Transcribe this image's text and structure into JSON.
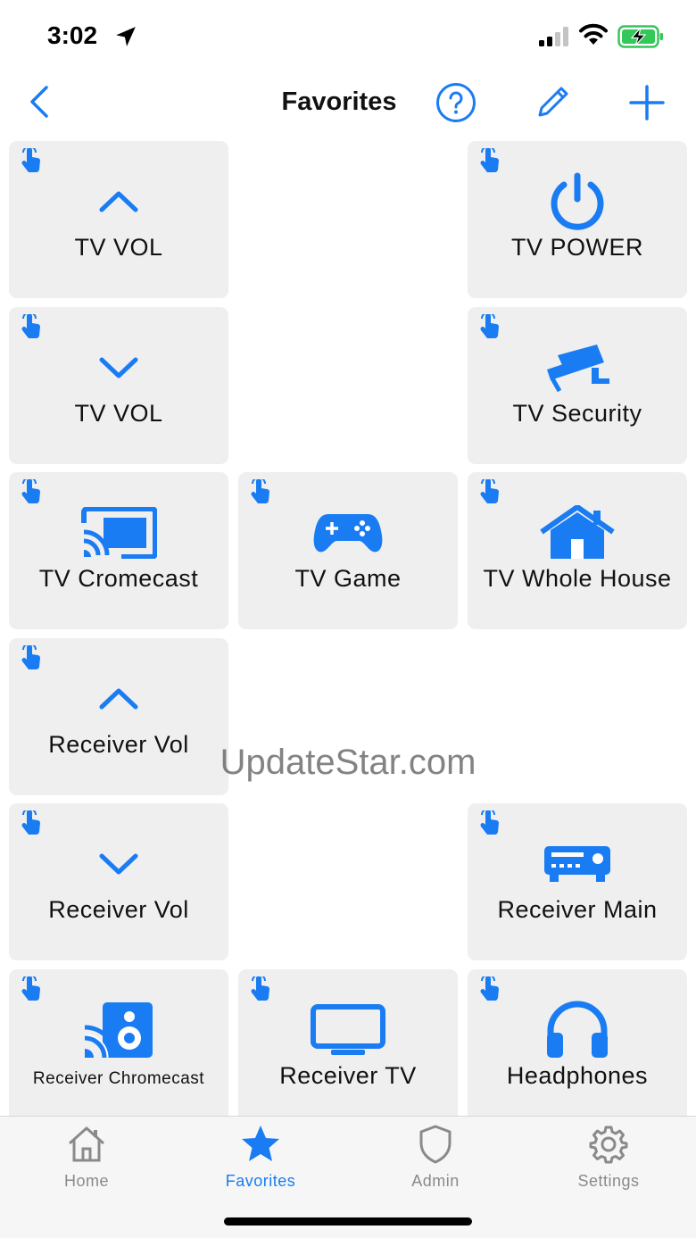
{
  "status_bar": {
    "time": "3:02"
  },
  "nav": {
    "title": "Favorites"
  },
  "colors": {
    "accent": "#1a7cf2",
    "tile_bg": "#efefef",
    "tab_inactive": "#8a8a8a"
  },
  "tiles": [
    {
      "label": "TV VOL",
      "icon": "chevron-up-icon"
    },
    {
      "label": "TV POWER",
      "icon": "power-icon"
    },
    {
      "label": "TV VOL",
      "icon": "chevron-down-icon"
    },
    {
      "label": "TV Security",
      "icon": "security-camera-icon"
    },
    {
      "label": "TV Cromecast",
      "icon": "cast-icon"
    },
    {
      "label": "TV Game",
      "icon": "gamepad-icon"
    },
    {
      "label": "TV Whole House",
      "icon": "house-icon"
    },
    {
      "label": "Receiver Vol",
      "icon": "chevron-up-icon"
    },
    {
      "label": "Receiver Vol",
      "icon": "chevron-down-icon"
    },
    {
      "label": "Receiver Main",
      "icon": "av-receiver-icon"
    },
    {
      "label": "Receiver Chromecast",
      "icon": "cast-speaker-icon"
    },
    {
      "label": "Receiver TV",
      "icon": "tv-icon"
    },
    {
      "label": "Headphones",
      "icon": "headphones-icon"
    }
  ],
  "watermark": "UpdateStar.com",
  "tab_bar": {
    "items": [
      {
        "label": "Home",
        "icon": "home-icon",
        "active": false
      },
      {
        "label": "Favorites",
        "icon": "star-icon",
        "active": true
      },
      {
        "label": "Admin",
        "icon": "shield-icon",
        "active": false
      },
      {
        "label": "Settings",
        "icon": "gear-icon",
        "active": false
      }
    ]
  }
}
